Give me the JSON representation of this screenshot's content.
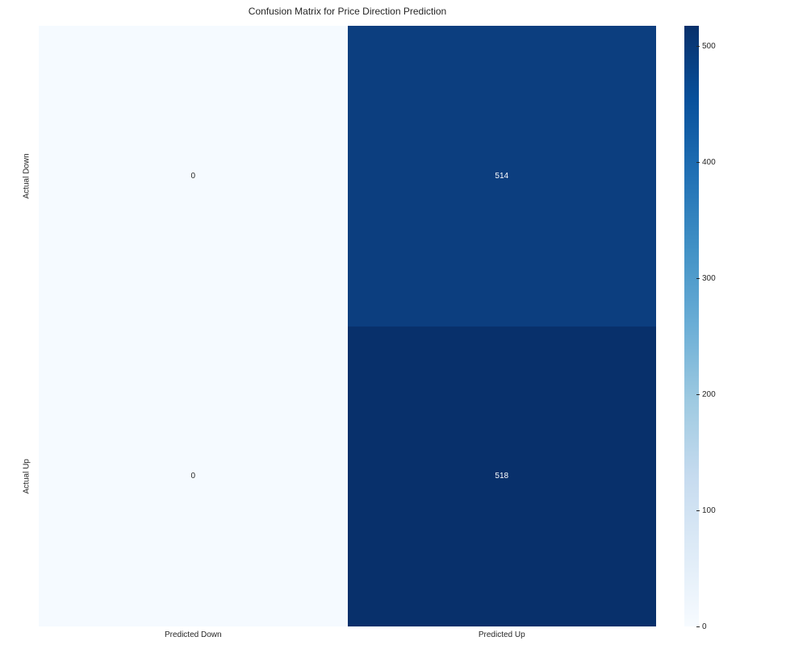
{
  "chart_data": {
    "type": "heatmap",
    "title": "Confusion Matrix for Price Direction Prediction",
    "x_categories": [
      "Predicted Down",
      "Predicted Up"
    ],
    "y_categories": [
      "Actual Down",
      "Actual Up"
    ],
    "matrix": [
      [
        0,
        514
      ],
      [
        0,
        518
      ]
    ],
    "colorbar": {
      "min": 0,
      "max": 518,
      "ticks": [
        0,
        100,
        200,
        300,
        400,
        500
      ]
    },
    "colormap": "Blues"
  }
}
